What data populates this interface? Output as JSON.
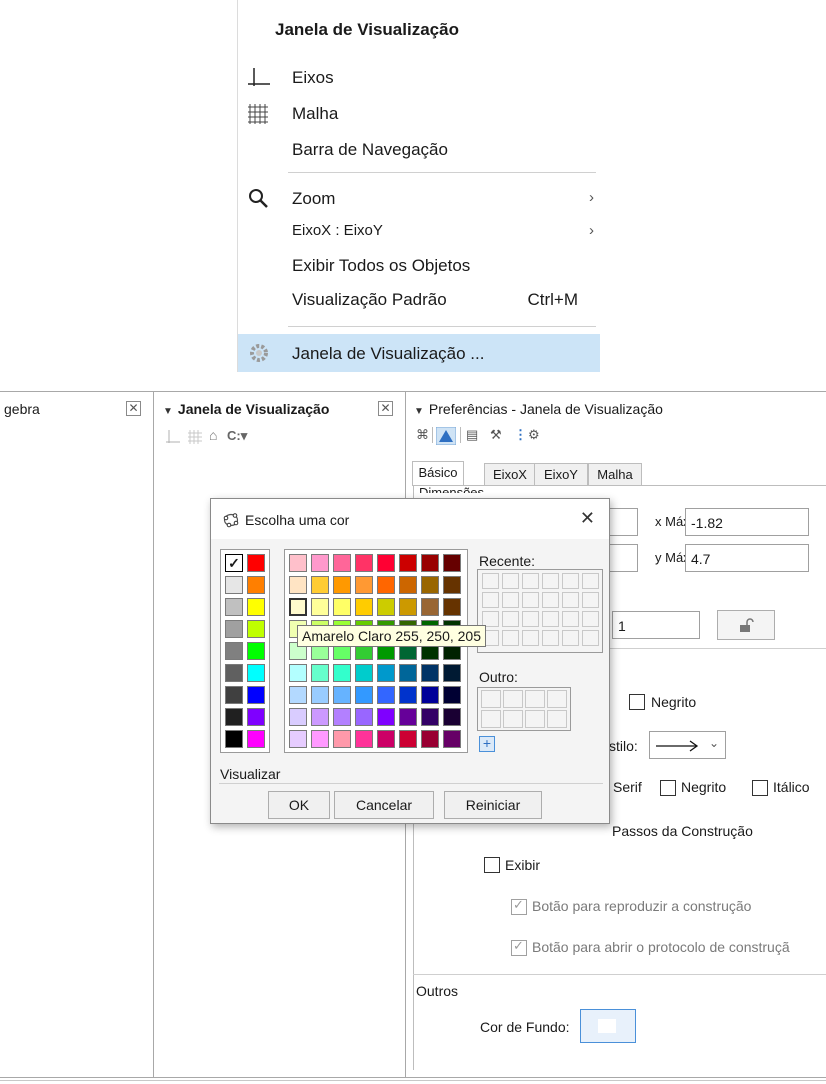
{
  "menu": {
    "title": "Janela de Visualização",
    "items": [
      {
        "label": "Eixos",
        "icon": "axes-icon"
      },
      {
        "label": "Malha",
        "icon": "grid-icon"
      },
      {
        "label": "Barra de Navegação"
      },
      {
        "label": "Zoom",
        "icon": "magnifier-icon",
        "submenu": "›"
      },
      {
        "label": "EixoX : EixoY",
        "submenu": "›"
      },
      {
        "label": "Exibir Todos os Objetos"
      },
      {
        "label": "Visualização Padrão",
        "shortcut": "Ctrl+M"
      },
      {
        "label": "Janela de Visualização ...",
        "icon": "gear-icon"
      }
    ]
  },
  "panels": {
    "algebra_title": "ɡebra",
    "view_title": "Janela de Visualização",
    "prefs_title": "Preferências - Janela de Visualização"
  },
  "prefs": {
    "tabs": [
      "Básico",
      "EixoX",
      "EixoY",
      "Malha"
    ],
    "dimensoes": "Dimensões",
    "xmax_label": "x Máx:",
    "xmax_value": "-1.82",
    "ymax_label": "y Máx:",
    "ymax_value": "4.7",
    "ratio_value": "1",
    "negrito": "Negrito",
    "estilo_label": "stilo:",
    "serif": "Serif",
    "negrito2": "Negrito",
    "italico": "Itálico",
    "passos": "Passos da Construção",
    "exibir": "Exibir",
    "botao_reproduzir": "Botão para reproduzir a construção",
    "botao_protocolo": "Botão para abrir o protocolo de construçã",
    "outros": "Outros",
    "cor_fundo": "Cor de Fundo:"
  },
  "dialog": {
    "title": "Escolha uma cor",
    "recente": "Recente:",
    "outro": "Outro:",
    "visualizar": "Visualizar",
    "tooltip": "Amarelo Claro  255, 250, 205",
    "ok": "OK",
    "cancelar": "Cancelar",
    "reiniciar": "Reiniciar",
    "left_colors": [
      [
        "#ffffff",
        "#ff0000"
      ],
      [
        "#e6e6e6",
        "#ff7f00"
      ],
      [
        "#c0c0c0",
        "#ffff00"
      ],
      [
        "#a0a0a0",
        "#bfff00"
      ],
      [
        "#808080",
        "#00ff00"
      ],
      [
        "#606060",
        "#00ffff"
      ],
      [
        "#404040",
        "#0000ff"
      ],
      [
        "#202020",
        "#7f00ff"
      ],
      [
        "#000000",
        "#ff00ff"
      ]
    ],
    "grid_colors": [
      [
        "#ffc0cb",
        "#ff99cc",
        "#ff6699",
        "#ff3366",
        "#ff0033",
        "#cc0000",
        "#990000",
        "#660000"
      ],
      [
        "#ffe4c4",
        "#ffcc33",
        "#ff9900",
        "#ff9933",
        "#ff6600",
        "#cc6600",
        "#996600",
        "#663300"
      ],
      [
        "#fffacd",
        "#ffff99",
        "#ffff66",
        "#ffcc00",
        "#cccc00",
        "#cc9900",
        "#996633",
        "#663300"
      ],
      [
        "#f0ffb0",
        "#ccff66",
        "#99ff33",
        "#66cc00",
        "#339900",
        "#336600",
        "#006600",
        "#003300"
      ],
      [
        "#ccffcc",
        "#99ff99",
        "#66ff66",
        "#33cc33",
        "#009900",
        "#006633",
        "#003300",
        "#002200"
      ],
      [
        "#b3ffff",
        "#66ffcc",
        "#33ffcc",
        "#00cccc",
        "#0099cc",
        "#006699",
        "#003366",
        "#001a33"
      ],
      [
        "#b3d9ff",
        "#99ccff",
        "#66b3ff",
        "#3399ff",
        "#3366ff",
        "#0033cc",
        "#000099",
        "#000033"
      ],
      [
        "#d9ccff",
        "#cc99ff",
        "#b380ff",
        "#9966ff",
        "#7f00ff",
        "#660099",
        "#330066",
        "#1a0033"
      ],
      [
        "#e6ccff",
        "#ff99ff",
        "#ff99aa",
        "#ff3399",
        "#cc0066",
        "#cc0033",
        "#990033",
        "#660066"
      ]
    ]
  }
}
